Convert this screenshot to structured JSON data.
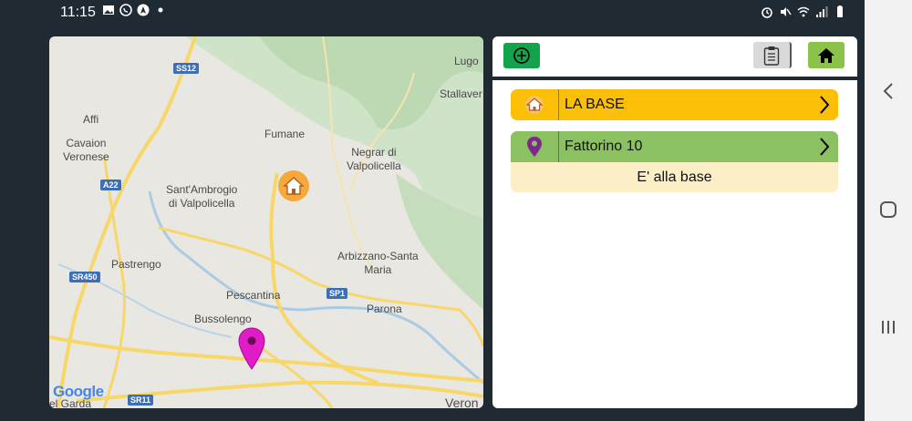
{
  "status_bar": {
    "time": "11:15",
    "left_icons": [
      "image-icon",
      "whatsapp-icon",
      "nav-app-icon",
      "dot-icon"
    ],
    "right_icons": [
      "alarm-icon",
      "mute-icon",
      "wifi-icon",
      "signal-icon",
      "battery-icon"
    ]
  },
  "map": {
    "places": [
      {
        "name": "Lugo"
      },
      {
        "name": "Stallaver"
      },
      {
        "name": "Affi"
      },
      {
        "name": "Cavaion\nVeronese"
      },
      {
        "name": "Fumane"
      },
      {
        "name": "Negrar di\nValpolicella"
      },
      {
        "name": "Sant'Ambrogio\ndi Valpolicella"
      },
      {
        "name": "Pastrengo"
      },
      {
        "name": "Arbizzano-Santa\nMaria"
      },
      {
        "name": "Pescantina"
      },
      {
        "name": "Parona"
      },
      {
        "name": "Bussolengo"
      },
      {
        "name": "el Garda"
      },
      {
        "name": "Veron"
      }
    ],
    "roads": [
      "SS12",
      "A22",
      "SR450",
      "SP1",
      "SR11"
    ],
    "attribution": "Google",
    "base_marker_icon": "home-icon",
    "courier_marker_icon": "map-pin-icon"
  },
  "toolbar": {
    "add_icon": "plus-circle-icon",
    "report_icon": "clipboard-icon",
    "home_icon": "home-icon"
  },
  "list": {
    "base": {
      "label": "LA BASE",
      "icon": "home-icon",
      "color": "#fbbf08"
    },
    "courier": {
      "label": "Fattorino 10",
      "icon": "map-pin-icon",
      "status": "E' alla base",
      "color": "#8bc160"
    }
  },
  "navbar": {
    "back_icon": "chevron-left-icon",
    "home_icon": "circle-home-icon",
    "recents_icon": "recents-icon"
  }
}
